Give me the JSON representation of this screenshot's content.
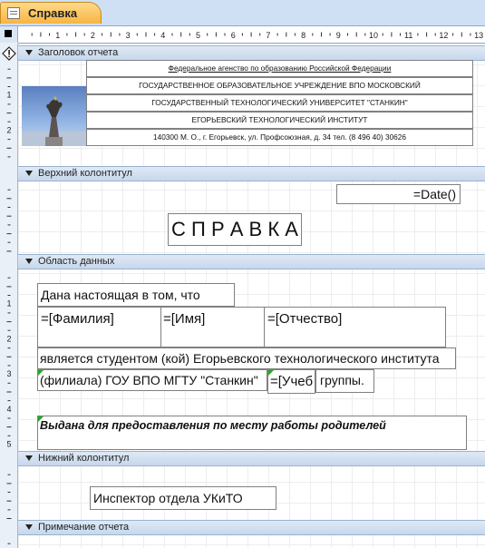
{
  "tab": {
    "title": "Справка"
  },
  "ruler": {
    "numbers": [
      "1",
      "2",
      "3",
      "4",
      "5",
      "6",
      "7",
      "8",
      "9",
      "10",
      "11",
      "12",
      "13"
    ]
  },
  "vruler": {
    "numbers_header": [
      "1",
      "2",
      "3"
    ],
    "numbers_data": [
      "1",
      "2",
      "3",
      "4",
      "5"
    ]
  },
  "sections": {
    "report_header": "Заголовок отчета",
    "page_header": "Верхний колонтитул",
    "detail": "Область данных",
    "page_footer": "Нижний колонтитул",
    "report_footer": "Примечание отчета"
  },
  "report_header": {
    "line1": "Федеральное агенство по образованию Российской Федерации",
    "line2": "ГОСУДАРСТВЕННОЕ ОБРАЗОВАТЕЛЬНОЕ УЧРЕЖДЕНИЕ ВПО МОСКОВСКИЙ",
    "line3": "ГОСУДАРСТВЕННЫЙ ТЕХНОЛОГИЧЕСКИЙ УНИВЕРСИТЕТ \"СТАНКИН\"",
    "line4": "ЕГОРЬЕВСКИЙ ТЕХНОЛОГИЧЕСКИЙ ИНСТИТУТ",
    "line5": "140300 М. О., г. Егорьевск, ул. Профсоюзная, д. 34 тел. (8 496 40) 30626"
  },
  "page_header": {
    "date": "=Date()",
    "title": "С П Р А В К А"
  },
  "detail": {
    "intro": "Дана настоящая в том, что",
    "surname": "=[Фамилия]",
    "name": "=[Имя]",
    "patronymic": "=[Отчество]",
    "student_line": "является студентом (кой) Егорьевского технологического института",
    "branch": "(филиала) ГОУ ВПО МГТУ \"Станкин\"",
    "group_field": "=[Учеб",
    "group_label": "группы.",
    "purpose": "Выдана для предоставления по месту работы родителей"
  },
  "page_footer": {
    "inspector": "Инспектор отдела УКиТО"
  },
  "colors": {
    "tab": "#f7b543",
    "section_bar": "#c7d7ec",
    "marker": "#22aa22"
  }
}
